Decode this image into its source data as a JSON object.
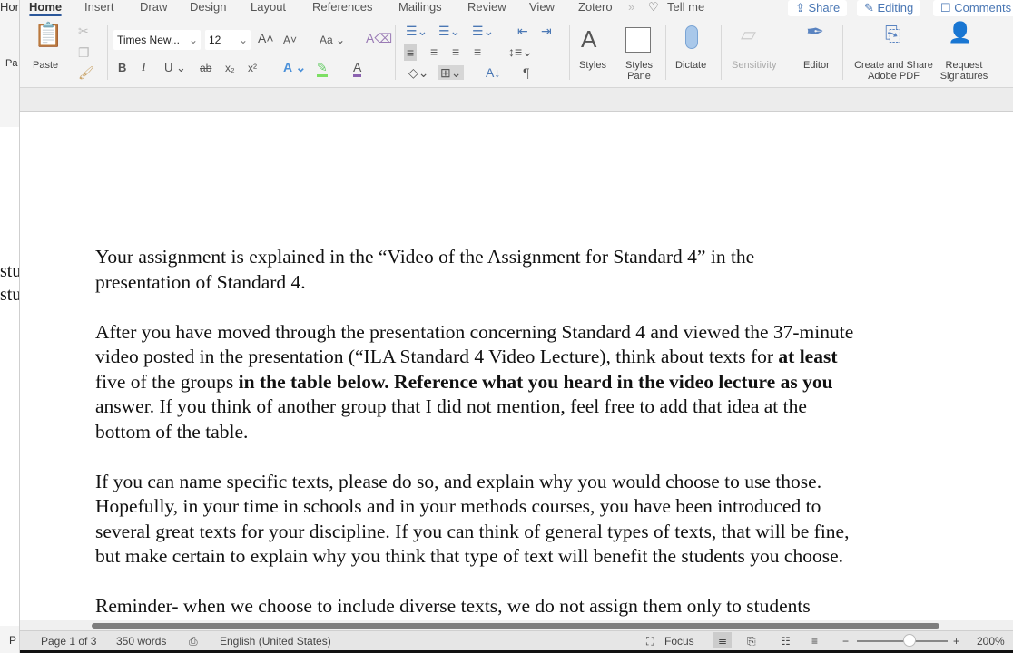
{
  "background_window": {
    "tab": "Hor",
    "paste": "Pa",
    "line1": "stu",
    "line2": "stu",
    "status": "P"
  },
  "ribbon_tabs": [
    "Home",
    "Insert",
    "Draw",
    "Design",
    "Layout",
    "References",
    "Mailings",
    "Review",
    "View",
    "Zotero"
  ],
  "tell_me": "Tell me",
  "top_buttons": {
    "share": "Share",
    "editing": "Editing",
    "comments": "Comments"
  },
  "font": {
    "name": "Times New...",
    "size": "12"
  },
  "ribbon": {
    "paste": "Paste",
    "styles": "Styles",
    "styles_pane": "Styles Pane",
    "dictate": "Dictate",
    "sensitivity": "Sensitivity",
    "editor": "Editor",
    "adobe": "Create and Share Adobe PDF",
    "signatures": "Request Signatures"
  },
  "document": {
    "paragraphs": [
      [
        "Your assignment is explained in the “Video of the Assignment for Standard 4” in the",
        "presentation of Standard 4."
      ],
      [
        "After you have moved through the presentation concerning Standard 4 and viewed the 37-minute",
        "video posted in the presentation (“ILA Standard 4 Video Lecture), think about texts for |at least",
        "five of the groups| in the table below. Reference what you heard in the video lecture as you",
        "answer. If you think of another group that I did not mention, feel free to add that idea at the",
        "bottom of the table."
      ],
      [
        "If you can name specific texts, please do so, and explain why you would choose to use those.",
        "Hopefully, in your time in schools and in your methods courses, you have been introduced to",
        "several great texts for your discipline. If you can think of general types of texts, that will be fine,",
        "but make certain to explain why you think that type of text will benefit the students you choose."
      ],
      [
        "Reminder- when we choose to include diverse texts, we do not assign them only to students"
      ]
    ]
  },
  "status": {
    "page": "Page 1 of 3",
    "words": "350 words",
    "language": "English (United States)",
    "focus": "Focus",
    "zoom": "200%",
    "zoom_percent": 200
  },
  "colors": {
    "accent": "#2b579a",
    "link": "#4a77b4"
  }
}
